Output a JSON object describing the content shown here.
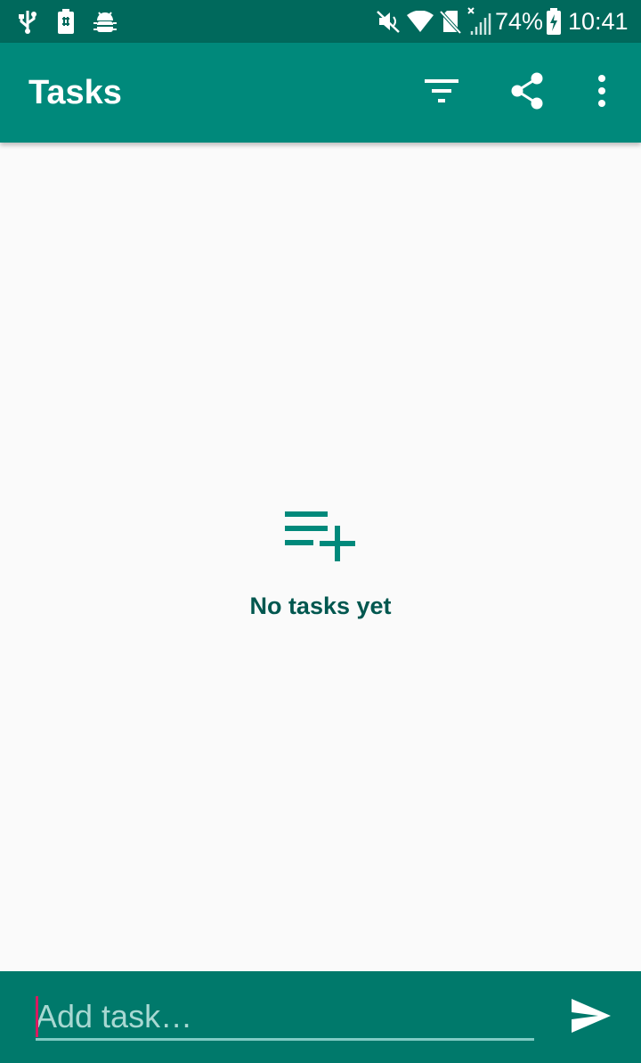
{
  "status_bar": {
    "left_icons": [
      "usb-icon",
      "battery-saver-icon",
      "android-debug-icon"
    ],
    "right_icons": [
      "mute-icon",
      "wifi-icon",
      "no-sim-icon",
      "signal-off-icon"
    ],
    "battery_percent": "74%",
    "time": "10:41"
  },
  "app_bar": {
    "title": "Tasks",
    "actions": [
      "filter-icon",
      "share-icon",
      "more-vert-icon"
    ]
  },
  "empty_state": {
    "icon": "playlist-add-icon",
    "message": "No tasks yet"
  },
  "bottom_bar": {
    "input_value": "",
    "input_placeholder": "Add task…",
    "send_icon": "send-icon"
  },
  "colors": {
    "status_bar": "#00695c",
    "app_bar": "#00897b",
    "bottom_bar": "#00796b",
    "accent": "#d81b60",
    "empty_text": "#00574f",
    "background": "#fafafa"
  }
}
